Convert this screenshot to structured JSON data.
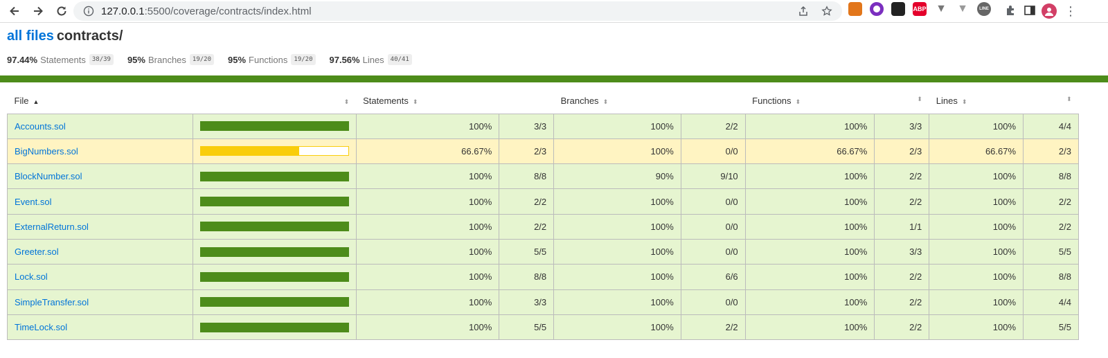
{
  "browser": {
    "url_host": "127.0.0.1",
    "url_path": ":5500/coverage/contracts/index.html",
    "extensions": [
      {
        "name": "metamask-icon",
        "color": "#e2761b",
        "label": ""
      },
      {
        "name": "purple-circle-icon",
        "color": "#7b2fbf",
        "label": ""
      },
      {
        "name": "cat-icon",
        "color": "#222222",
        "label": ""
      },
      {
        "name": "adblock-icon",
        "color": "#e4002b",
        "label": "ABP"
      },
      {
        "name": "vue-devtools-icon",
        "color": "#777777",
        "label": ""
      },
      {
        "name": "vue-devtools-alt-icon",
        "color": "#999999",
        "label": ""
      },
      {
        "name": "line-icon",
        "color": "#666666",
        "label": "LINE"
      }
    ]
  },
  "header": {
    "root_link": "all files",
    "current_dir": "contracts/"
  },
  "summary": [
    {
      "pct": "97.44%",
      "label": "Statements",
      "frac": "38/39"
    },
    {
      "pct": "95%",
      "label": "Branches",
      "frac": "19/20"
    },
    {
      "pct": "95%",
      "label": "Functions",
      "frac": "19/20"
    },
    {
      "pct": "97.56%",
      "label": "Lines",
      "frac": "40/41"
    }
  ],
  "columns": {
    "file": "File",
    "statements": "Statements",
    "branches": "Branches",
    "functions": "Functions",
    "lines": "Lines"
  },
  "rows": [
    {
      "file": "Accounts.sol",
      "level": "high",
      "bar_fill": 100,
      "stmt_pct": "100%",
      "stmt": "3/3",
      "br_pct": "100%",
      "br": "2/2",
      "fn_pct": "100%",
      "fn": "3/3",
      "ln_pct": "100%",
      "ln": "4/4"
    },
    {
      "file": "BigNumbers.sol",
      "level": "medium",
      "bar_fill": 66.67,
      "stmt_pct": "66.67%",
      "stmt": "2/3",
      "br_pct": "100%",
      "br": "0/0",
      "fn_pct": "66.67%",
      "fn": "2/3",
      "ln_pct": "66.67%",
      "ln": "2/3"
    },
    {
      "file": "BlockNumber.sol",
      "level": "high",
      "bar_fill": 100,
      "stmt_pct": "100%",
      "stmt": "8/8",
      "br_pct": "90%",
      "br": "9/10",
      "fn_pct": "100%",
      "fn": "2/2",
      "ln_pct": "100%",
      "ln": "8/8"
    },
    {
      "file": "Event.sol",
      "level": "high",
      "bar_fill": 100,
      "stmt_pct": "100%",
      "stmt": "2/2",
      "br_pct": "100%",
      "br": "0/0",
      "fn_pct": "100%",
      "fn": "2/2",
      "ln_pct": "100%",
      "ln": "2/2"
    },
    {
      "file": "ExternalReturn.sol",
      "level": "high",
      "bar_fill": 100,
      "stmt_pct": "100%",
      "stmt": "2/2",
      "br_pct": "100%",
      "br": "0/0",
      "fn_pct": "100%",
      "fn": "1/1",
      "ln_pct": "100%",
      "ln": "2/2"
    },
    {
      "file": "Greeter.sol",
      "level": "high",
      "bar_fill": 100,
      "stmt_pct": "100%",
      "stmt": "5/5",
      "br_pct": "100%",
      "br": "0/0",
      "fn_pct": "100%",
      "fn": "3/3",
      "ln_pct": "100%",
      "ln": "5/5"
    },
    {
      "file": "Lock.sol",
      "level": "high",
      "bar_fill": 100,
      "stmt_pct": "100%",
      "stmt": "8/8",
      "br_pct": "100%",
      "br": "6/6",
      "fn_pct": "100%",
      "fn": "2/2",
      "ln_pct": "100%",
      "ln": "8/8"
    },
    {
      "file": "SimpleTransfer.sol",
      "level": "high",
      "bar_fill": 100,
      "stmt_pct": "100%",
      "stmt": "3/3",
      "br_pct": "100%",
      "br": "0/0",
      "fn_pct": "100%",
      "fn": "2/2",
      "ln_pct": "100%",
      "ln": "4/4"
    },
    {
      "file": "TimeLock.sol",
      "level": "high",
      "bar_fill": 100,
      "stmt_pct": "100%",
      "stmt": "5/5",
      "br_pct": "100%",
      "br": "2/2",
      "fn_pct": "100%",
      "fn": "2/2",
      "ln_pct": "100%",
      "ln": "5/5"
    }
  ]
}
